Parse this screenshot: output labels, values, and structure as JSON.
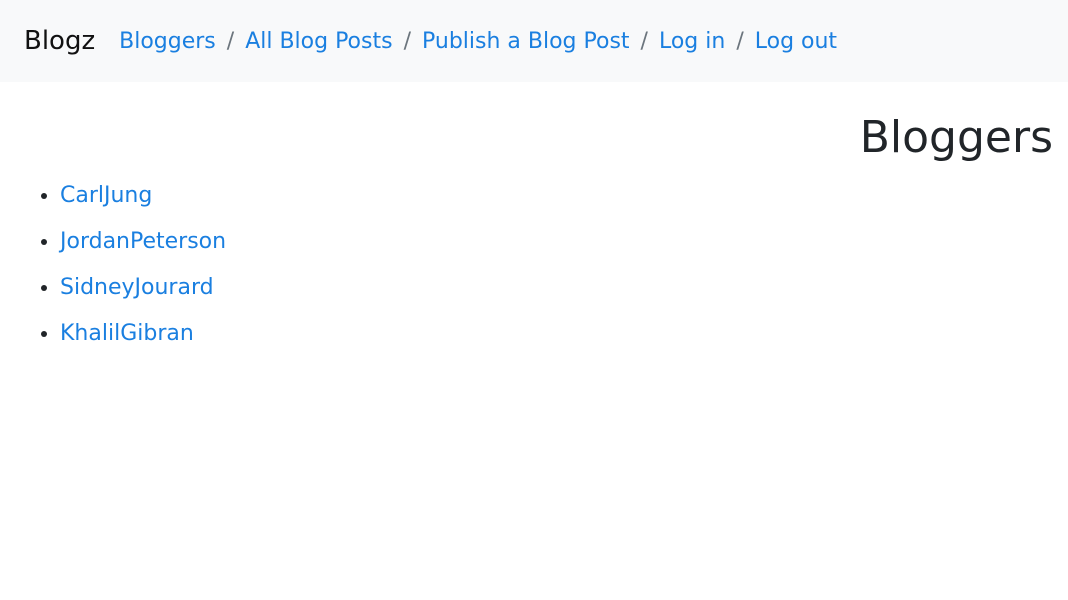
{
  "navbar": {
    "brand": "Blogz",
    "links": [
      {
        "label": "Bloggers"
      },
      {
        "label": "All Blog Posts"
      },
      {
        "label": "Publish a Blog Post"
      },
      {
        "label": "Log in"
      },
      {
        "label": "Log out"
      }
    ],
    "separator": "/"
  },
  "main": {
    "title": "Bloggers",
    "bloggers": [
      {
        "name": "CarlJung"
      },
      {
        "name": "JordanPeterson"
      },
      {
        "name": "SidneyJourard"
      },
      {
        "name": "KhalilGibran"
      }
    ]
  },
  "colors": {
    "link": "#1a7fe0",
    "navbar_bg": "#f8f9fa",
    "text": "#212529",
    "separator": "#6c757d"
  }
}
